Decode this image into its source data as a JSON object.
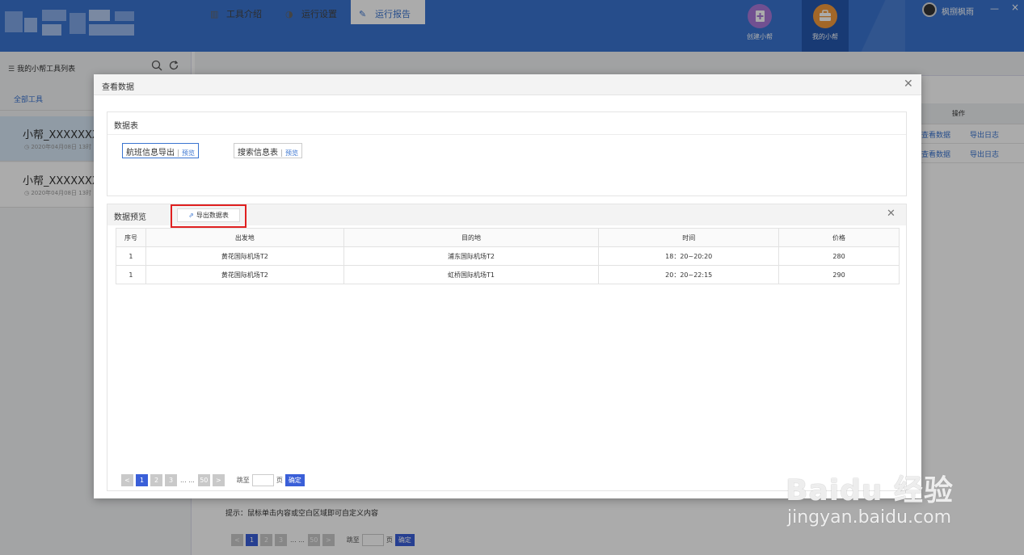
{
  "header": {
    "nav": [
      {
        "label": "创建小帮",
        "icon": "document-plus-icon"
      },
      {
        "label": "我的小帮",
        "icon": "toolbox-icon"
      }
    ],
    "user_name": "枫捌枫雨",
    "minimize": "—",
    "close": "×"
  },
  "sidebar": {
    "title": "我的小帮工具列表",
    "all_tools": "全部工具",
    "items": [
      {
        "title": "小帮_XXXXXXXX",
        "date": "2020年04月08日 13时"
      },
      {
        "title": "小帮_XXXXXXXX",
        "date": "2020年04月08日 13时"
      }
    ]
  },
  "tabs": [
    {
      "label": "工具介绍",
      "icon": "book-icon"
    },
    {
      "label": "运行设置",
      "icon": "play-circle-icon"
    },
    {
      "label": "运行报告",
      "icon": "edit-report-icon",
      "active": true
    }
  ],
  "bg_table": {
    "op_header": "操作",
    "rows": [
      {
        "view": "查看数据",
        "log": "导出日志"
      },
      {
        "view": "查看数据",
        "log": "导出日志"
      }
    ]
  },
  "bg_hint": "提示：鼠标单击内容或空白区域即可自定义内容",
  "modal": {
    "title": "查看数据",
    "datasets_title": "数据表",
    "datasets": [
      {
        "label": "航班信息导出",
        "preview": "预览"
      },
      {
        "label": "搜索信息表",
        "preview": "预览"
      }
    ],
    "preview_title": "数据预览",
    "export_label": "导出数据表",
    "columns": [
      "序号",
      "出发地",
      "目的地",
      "时间",
      "价格"
    ],
    "rows": [
      [
        "1",
        "黄花国际机场T2",
        "浦东国际机场T2",
        "18：20~20:20",
        "280"
      ],
      [
        "1",
        "黄花国际机场T2",
        "虹桥国际机场T1",
        "20：20~22:15",
        "290"
      ]
    ]
  },
  "pager": {
    "prev": "<",
    "pages": [
      "1",
      "2",
      "3"
    ],
    "ellipsis": "... ...",
    "last": "50",
    "next": ">",
    "jump_label": "跳至",
    "page_unit": "页",
    "confirm": "确定"
  },
  "watermark": {
    "brand": "Baidu 经验",
    "url": "jingyan.baidu.com"
  },
  "colors": {
    "primary": "#3a74d0",
    "highlight": "#e02020",
    "pager_active": "#3a5fd8"
  }
}
